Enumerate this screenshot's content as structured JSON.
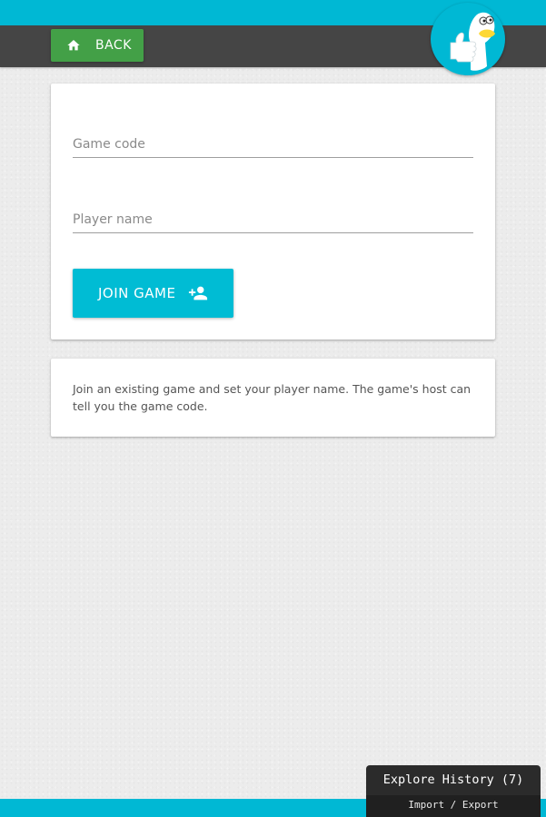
{
  "toolbar": {
    "back_label": "BACK",
    "back_icon": "home-icon"
  },
  "logo": {
    "icon": "thumbs-up-duck-icon"
  },
  "form": {
    "game_code": {
      "value": "",
      "placeholder": "Game code"
    },
    "player_name": {
      "value": "",
      "placeholder": "Player name"
    },
    "join_label": "JOIN GAME",
    "join_icon": "add-person-icon"
  },
  "info": {
    "text": "Join an existing game and set your player name. The game's host can tell you the game code."
  },
  "history": {
    "title": "Explore History (7)",
    "subtitle": "Import / Export"
  },
  "colors": {
    "accent": "#00bcd4",
    "toolbar": "#454545",
    "back_button": "#43a047",
    "background": "#ececec"
  }
}
